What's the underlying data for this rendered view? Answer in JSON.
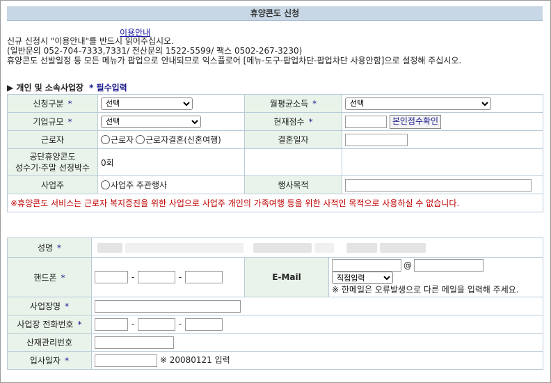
{
  "header": {
    "title": "휴양콘도 신청"
  },
  "notice": {
    "info_link": "이용안내",
    "line1": "신규 신청시 \"이용안내\"를 반드시 읽어주십시오.",
    "line2": "(일반문의 052-704-7333,7331/ 전산문의 1522-5599/ 팩스 0502-267-3230)",
    "line3": "휴양콘도 선발일정 등 모든 메뉴가 팝업으로 안내되므로 익스플로어 [메뉴-도구-팝업차단-팝업차단 사용안함]으로 설정해 주십시오."
  },
  "section1": {
    "title": "▶ 개인 및 소속사업장",
    "required_note": "* 필수입력"
  },
  "form1": {
    "application_type": {
      "label": "신청구분",
      "value": "선택"
    },
    "avg_income": {
      "label": "월평균소득",
      "value": "선택"
    },
    "company_size": {
      "label": "기업규모",
      "value": "선택"
    },
    "current_score": {
      "label": "현재점수",
      "value": "",
      "button": "본인점수확인"
    },
    "worker": {
      "label": "근로자",
      "option1": "근로자",
      "option2": "근로자결혼(신혼여행)"
    },
    "wedding_date": {
      "label": "결혼일자",
      "value": ""
    },
    "selection_count": {
      "label_line1": "공단휴양콘도",
      "label_line2": "성수기·주말 선정박수",
      "value": "0회"
    },
    "employer": {
      "label": "사업주",
      "option": "사업주 주관행사"
    },
    "event_purpose": {
      "label": "행사목적",
      "value": ""
    },
    "warning": "※휴양콘도 서비스는 근로자 복지증진을 위한 사업으로 사업주 개인의 가족여행 등을 위한 사적인 목적으로 사용하실 수 없습니다."
  },
  "form2": {
    "name": {
      "label": "성명"
    },
    "phone": {
      "label": "핸드폰"
    },
    "email": {
      "label": "E-Mail",
      "domain_select": "직접입력",
      "note": "※ 한메일은 오류발생으로 다른 메일을 입력해 주세요."
    },
    "workplace_name": {
      "label": "사업장명"
    },
    "workplace_phone": {
      "label": "사업장 전화번호"
    },
    "industrial_accident_no": {
      "label": "산재관리번호"
    },
    "hire_date": {
      "label": "입사일자",
      "note": "※ 20080121 입력"
    }
  },
  "colors": {
    "label_bg": "#e9f3ea",
    "title_bg": "#c8d7e6",
    "required": "#1a1a8c",
    "warning": "#c00000"
  }
}
